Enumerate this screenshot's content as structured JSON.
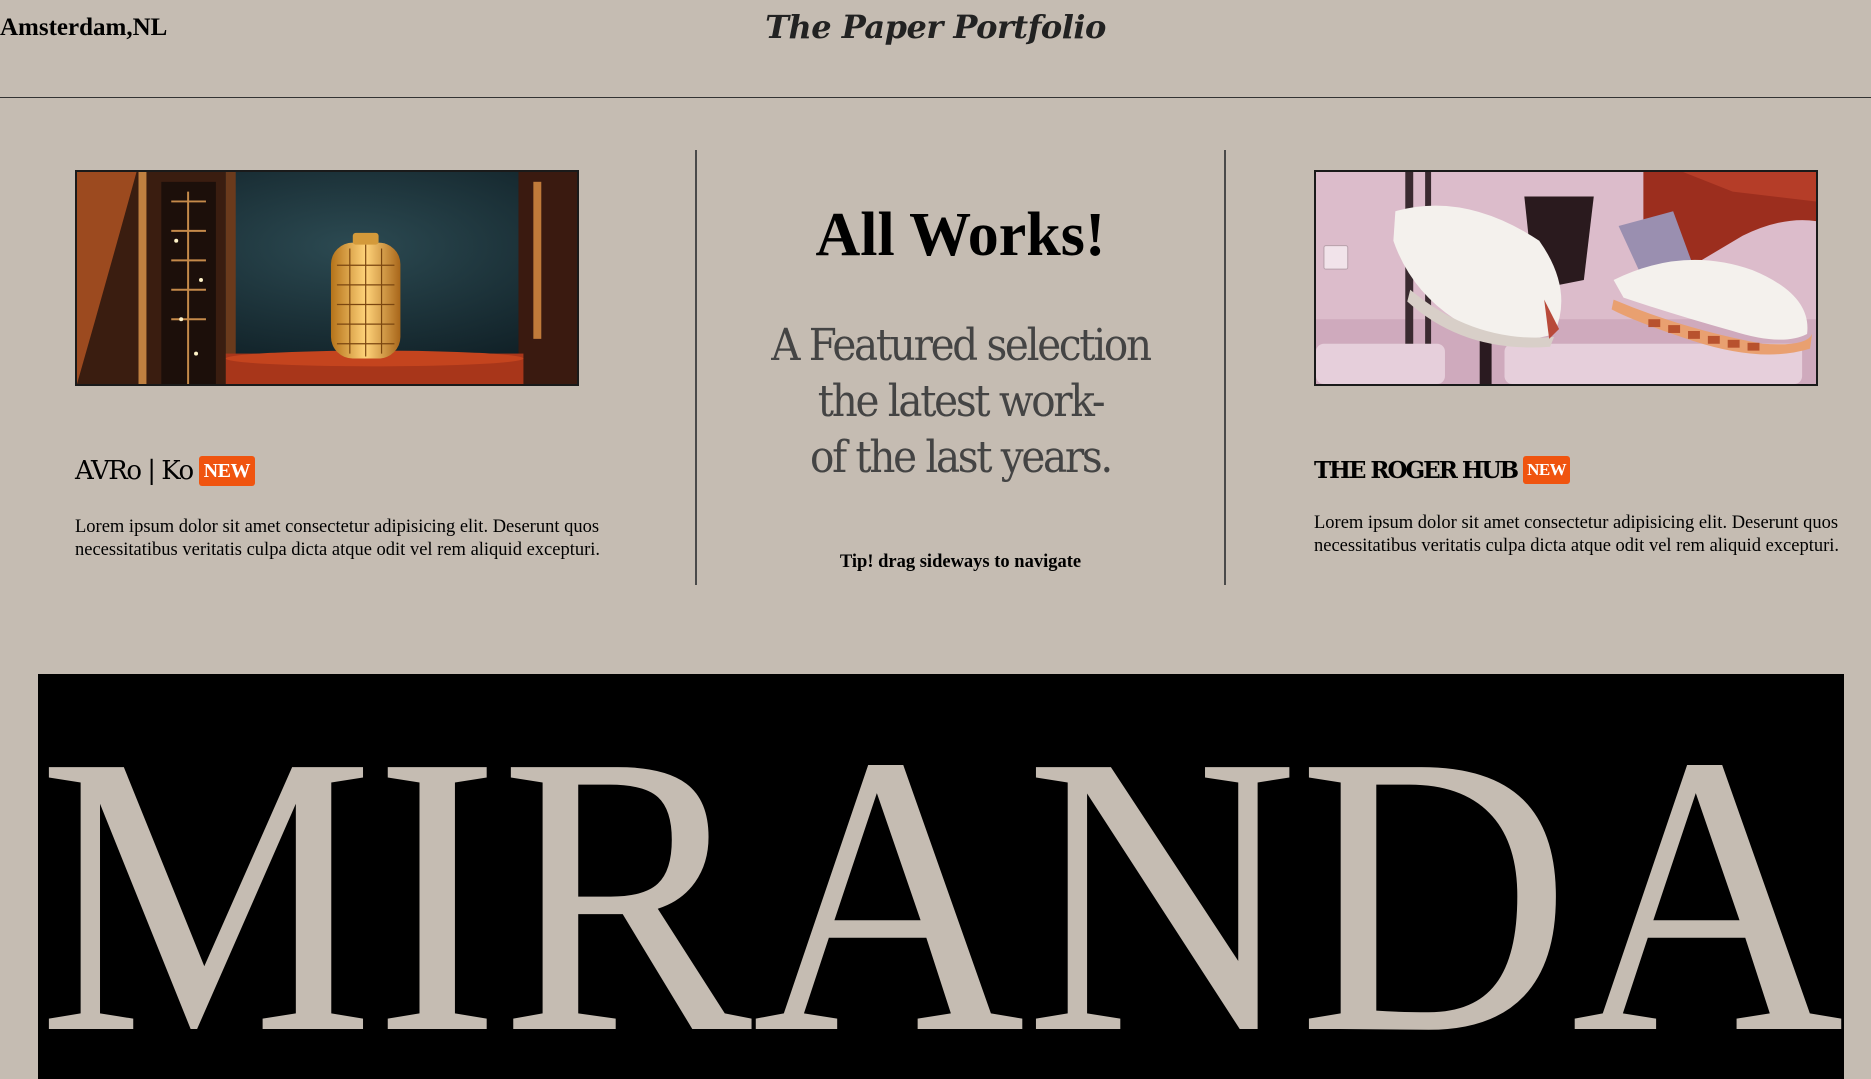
{
  "header": {
    "location": "Amsterdam,NL",
    "brand": "The Paper Portfolio"
  },
  "projects": [
    {
      "title": "AVRo | Ko",
      "badge": "NEW",
      "description": "Lorem ipsum dolor sit amet consectetur adipisicing elit. Deserunt quos necessitatibus veritatis culpa dicta atque odit vel rem aliquid excepturi."
    },
    {
      "title": "THE ROGER HUB",
      "badge": "NEW",
      "description": "Lorem ipsum dolor sit amet consectetur adipisicing elit. Deserunt quos necessitatibus veritatis culpa dicta atque odit vel rem aliquid excepturi."
    }
  ],
  "center": {
    "title": "All Works!",
    "subtitle_line1": "A Featured selection",
    "subtitle_line2": "the latest work-",
    "subtitle_line3": "of the last years.",
    "tip": "Tip! drag sideways to navigate"
  },
  "banner": {
    "text": "MIRANDA"
  },
  "colors": {
    "background": "#c5bcb2",
    "badge": "#f0540f",
    "banner_bg": "#000000",
    "banner_text": "#c5bcb2"
  }
}
